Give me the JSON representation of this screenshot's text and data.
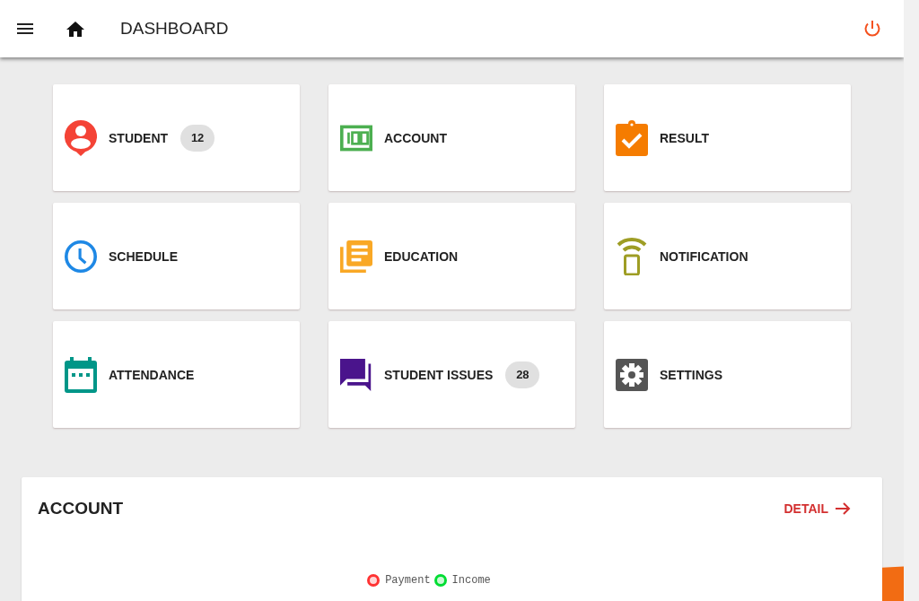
{
  "header": {
    "title": "DASHBOARD"
  },
  "tiles": [
    {
      "label": "STUDENT",
      "color": "#f44336",
      "badge": "12"
    },
    {
      "label": "ACCOUNT",
      "color": "#4caf50"
    },
    {
      "label": "RESULT",
      "color": "#f57c00"
    },
    {
      "label": "SCHEDULE",
      "color": "#1e88e5"
    },
    {
      "label": "EDUCATION",
      "color": "#f9a825"
    },
    {
      "label": "NOTIFICATION",
      "color": "#9e9d24"
    },
    {
      "label": "ATTENDANCE",
      "color": "#009688"
    },
    {
      "label": "STUDENT ISSUES",
      "color": "#4a148c",
      "badge": "28"
    },
    {
      "label": "SETTINGS",
      "color": "#555555"
    }
  ],
  "account_card": {
    "title": "ACCOUNT",
    "detail_link": "DETAIL",
    "legend": [
      {
        "label": "Payment",
        "color": "#ff3333"
      },
      {
        "label": "Income",
        "color": "#00dd33"
      }
    ]
  }
}
